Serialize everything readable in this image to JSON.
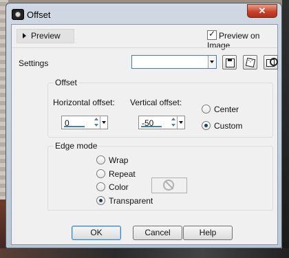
{
  "window": {
    "title": "Offset",
    "close_label": "✕"
  },
  "preview": {
    "toggle_label": "Preview",
    "preview_on_image_label": "Preview on Image",
    "preview_on_image_checked": true
  },
  "settings": {
    "label": "Settings",
    "value": ""
  },
  "offset_group": {
    "title": "Offset",
    "horizontal_label": "Horizontal offset:",
    "horizontal_value": "0",
    "vertical_label": "Vertical offset:",
    "vertical_value": "-50",
    "center_label": "Center",
    "custom_label": "Custom",
    "selected": "Custom"
  },
  "edge_mode": {
    "title": "Edge mode",
    "options": [
      "Wrap",
      "Repeat",
      "Color",
      "Transparent"
    ],
    "selected": "Transparent"
  },
  "buttons": {
    "ok": "OK",
    "cancel": "Cancel",
    "help": "Help"
  },
  "icons": [
    "camera-icon",
    "close-icon",
    "expand-triangle-icon",
    "save-preset-icon",
    "randomize-dice-icon",
    "load-preset-icon",
    "no-color-icon"
  ]
}
